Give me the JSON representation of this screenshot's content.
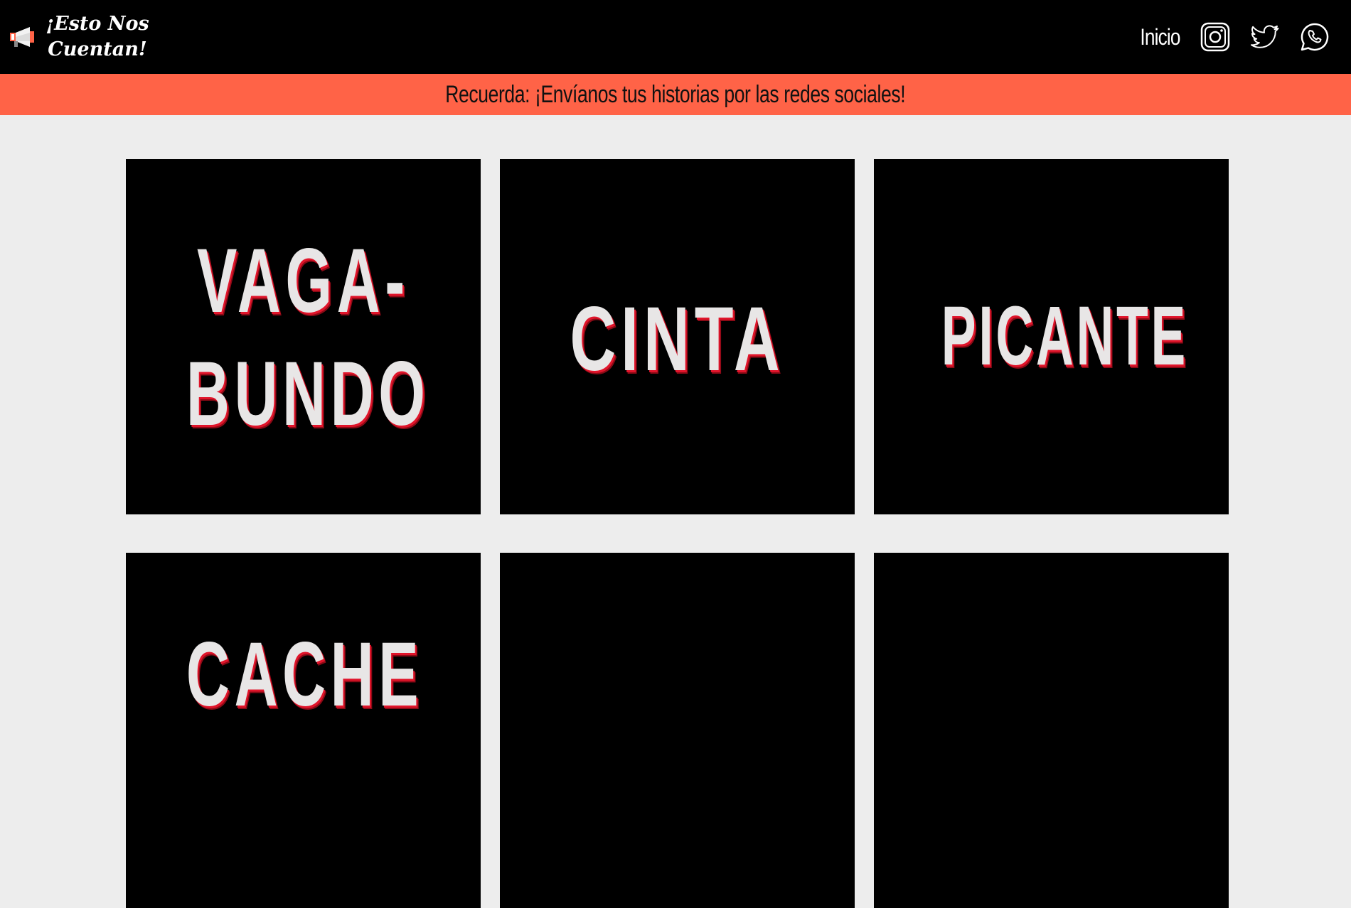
{
  "navbar": {
    "brand_title": "¡Esto Nos Cuentan!",
    "brand_icon": "megaphone-icon",
    "links": [
      {
        "label": "Inicio"
      }
    ],
    "social": [
      {
        "name": "instagram-icon"
      },
      {
        "name": "twitter-icon"
      },
      {
        "name": "whatsapp-icon"
      }
    ]
  },
  "banner": {
    "text": "Recuerda: ¡Envíanos tus historias por las redes sociales!",
    "color": "#ff6347"
  },
  "cards": [
    {
      "line1": "VAGA-",
      "line2": "BUNDO"
    },
    {
      "line1": "CINTA"
    },
    {
      "line1": "PICANTE"
    },
    {
      "line1": "CACHE"
    },
    {
      "line1": ""
    },
    {
      "line1": ""
    }
  ],
  "colors": {
    "background": "#ededed",
    "navbar": "#000000",
    "card": "#000000",
    "card_text": "#e8e6e6",
    "card_text_shadow": "#e0142a"
  }
}
